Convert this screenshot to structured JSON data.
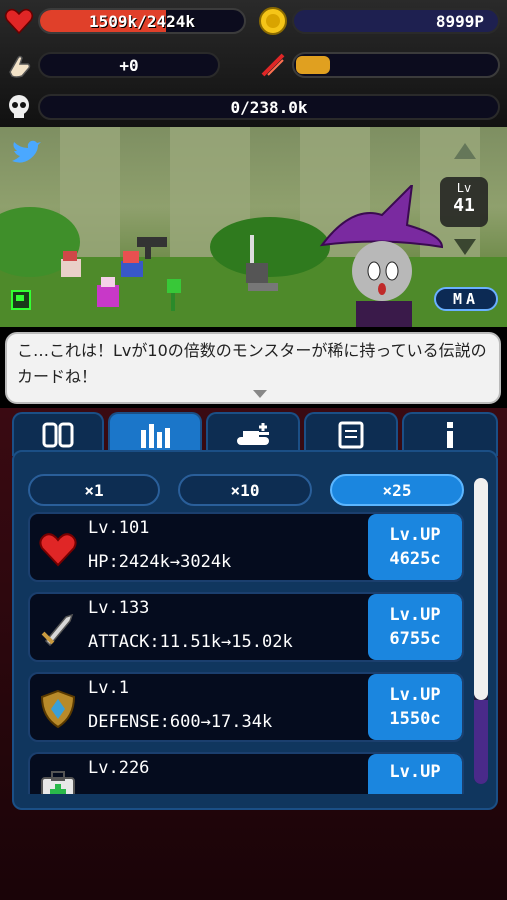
{
  "hud": {
    "hp_text": "1509k/2424k",
    "hp_fraction": 0.62,
    "coins": "8999P",
    "tap_power": "+0",
    "boss_text": "0/238.0k"
  },
  "scene": {
    "level_label": "Lv",
    "level_value": "41",
    "mode_label": "MA"
  },
  "dialog": {
    "text": "こ…これは！Lvが10の倍数のモンスターが稀に持っている伝説のカードね！"
  },
  "tabs": [
    {
      "name": "cards-tab-icon"
    },
    {
      "name": "stats-tab-icon"
    },
    {
      "name": "tank-tab-icon"
    },
    {
      "name": "book-tab-icon"
    },
    {
      "name": "info-tab-icon"
    }
  ],
  "multipliers": [
    "×1",
    "×10",
    "×25"
  ],
  "upgrades": [
    {
      "level": "Lv.101",
      "stat": "HP:2424k→3024k",
      "up_label": "Lv.UP",
      "cost": "4625c"
    },
    {
      "level": "Lv.133",
      "stat": "ATTACK:11.51k→15.02k",
      "up_label": "Lv.UP",
      "cost": "6755c"
    },
    {
      "level": "Lv.1",
      "stat": "DEFENSE:600→17.34k",
      "up_label": "Lv.UP",
      "cost": "1550c"
    },
    {
      "level": "Lv.226",
      "stat": "",
      "up_label": "Lv.UP",
      "cost": ""
    }
  ],
  "colors": {
    "hp_bar": "#e0402a",
    "accent_blue": "#1b86df",
    "gold": "#e0a020"
  }
}
